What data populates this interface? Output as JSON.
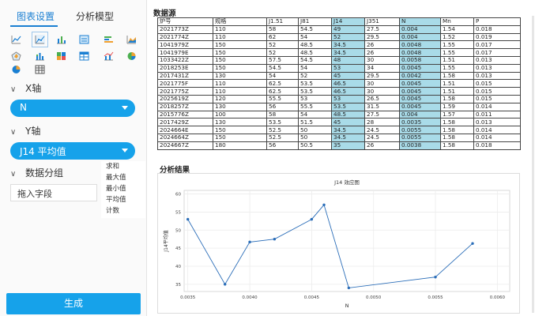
{
  "left_panel": {
    "tabs": [
      {
        "label": "图表设置",
        "active": true
      },
      {
        "label": "分析模型",
        "active": false
      }
    ],
    "chart_type_icons": [
      "line-chart-icon",
      "scatter-chart-icon",
      "bar-chart-icon",
      "column-chart-icon",
      "horizontal-bar-icon",
      "area-chart-icon",
      "radar-chart-icon",
      "stacked-bar-icon",
      "grid-heatmap-icon",
      "table-chart-icon",
      "combo-chart-icon",
      "pie3d-chart-icon",
      "pie-chart-icon",
      "data-table-icon"
    ],
    "selected_icon": "scatter-chart-icon",
    "x_axis": {
      "label": "X轴",
      "value": "N"
    },
    "y_axis": {
      "label": "Y轴",
      "value": "J14  平均值"
    },
    "group": {
      "label": "数据分组",
      "placeholder": "拖入字段"
    },
    "aggregations": [
      "求和",
      "最大值",
      "最小值",
      "平均值",
      "计数"
    ],
    "generate_label": "生成"
  },
  "data_section": {
    "title": "数据源",
    "columns": [
      "炉号",
      "规格",
      "J1.51",
      "J81",
      "J14",
      "J351",
      "N",
      "Mn",
      "P"
    ],
    "highlight_columns": [
      4,
      6
    ],
    "rows": [
      [
        "2021773Z",
        "110",
        "58",
        "54.5",
        "49",
        "27.5",
        "0.004",
        "1.54",
        "0.018"
      ],
      [
        "2021774Z",
        "110",
        "62",
        "54",
        "52",
        "29.5",
        "0.004",
        "1.52",
        "0.019"
      ],
      [
        "1041979Z",
        "150",
        "52",
        "48.5",
        "34.5",
        "26",
        "0.0048",
        "1.55",
        "0.017"
      ],
      [
        "1041979E",
        "150",
        "52",
        "48.5",
        "34.5",
        "26",
        "0.0048",
        "1.55",
        "0.017"
      ],
      [
        "1033422Z",
        "150",
        "57.5",
        "54.5",
        "48",
        "30",
        "0.0058",
        "1.51",
        "0.013"
      ],
      [
        "2018253E",
        "150",
        "54.5",
        "54",
        "53",
        "34",
        "0.0045",
        "1.55",
        "0.013"
      ],
      [
        "2017431Z",
        "130",
        "54",
        "52",
        "45",
        "29.5",
        "0.0042",
        "1.58",
        "0.013"
      ],
      [
        "2021775F",
        "110",
        "62.5",
        "53.5",
        "46.5",
        "30",
        "0.0045",
        "1.51",
        "0.015"
      ],
      [
        "2021775Z",
        "110",
        "62.5",
        "53.5",
        "46.5",
        "30",
        "0.0045",
        "1.51",
        "0.015"
      ],
      [
        "2025619Z",
        "120",
        "55.5",
        "53",
        "53",
        "26.5",
        "0.0045",
        "1.58",
        "0.015"
      ],
      [
        "2018257Z",
        "130",
        "56",
        "55.5",
        "53.5",
        "31.5",
        "0.0045",
        "1.59",
        "0.014"
      ],
      [
        "2015776Z",
        "100",
        "58",
        "54",
        "48.5",
        "27.5",
        "0.004",
        "1.57",
        "0.011"
      ],
      [
        "2017429Z",
        "130",
        "53.5",
        "51.5",
        "45",
        "28",
        "0.0035",
        "1.58",
        "0.013"
      ],
      [
        "2024664E",
        "150",
        "52.5",
        "50",
        "34.5",
        "24.5",
        "0.0055",
        "1.58",
        "0.014"
      ],
      [
        "2024664Z",
        "150",
        "52.5",
        "50",
        "34.5",
        "24.5",
        "0.0055",
        "1.58",
        "0.014"
      ],
      [
        "2024667Z",
        "180",
        "56",
        "50.5",
        "35",
        "26",
        "0.0038",
        "1.58",
        "0.018"
      ]
    ]
  },
  "analysis_title": "分析结果",
  "chart_data": {
    "type": "line",
    "title": "J14 效应图",
    "xlabel": "N",
    "ylabel": "J14平均值",
    "xlim": [
      0.00347,
      0.0061
    ],
    "ylim": [
      33,
      61
    ],
    "x_ticks": [
      "0.0035",
      "0.0040",
      "0.0045",
      "0.0050",
      "0.0055",
      "0.0060"
    ],
    "y_ticks": [
      "35",
      "40",
      "45",
      "50",
      "55",
      "60"
    ],
    "grid": true,
    "series": [
      {
        "x": [
          0.0035,
          0.0038,
          0.004,
          0.0042,
          0.0045,
          0.0046,
          0.0048,
          0.0055,
          0.0058
        ],
        "y": [
          53,
          35,
          46.7,
          47.5,
          53,
          57,
          34,
          37,
          46.3
        ]
      }
    ],
    "line_color": "#2a6db8"
  }
}
